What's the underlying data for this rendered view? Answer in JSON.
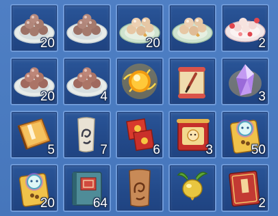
{
  "inventory": {
    "slots": [
      {
        "item": "dumpling-plate-icon",
        "count": "20"
      },
      {
        "item": "dumpling-plate-icon",
        "count": ""
      },
      {
        "item": "tangyuan-plate-icon",
        "count": "20"
      },
      {
        "item": "tangyuan-plate-icon",
        "count": ""
      },
      {
        "item": "tangyuan-flower-plate-icon",
        "count": "2"
      },
      {
        "item": "dumpling-plate-icon",
        "count": "20"
      },
      {
        "item": "dumpling-plate-icon",
        "count": "4"
      },
      {
        "item": "golden-orb-icon",
        "count": ""
      },
      {
        "item": "scroll-brush-icon",
        "count": ""
      },
      {
        "item": "purple-crystal-icon",
        "count": "3"
      },
      {
        "item": "orange-book-icon",
        "count": "5"
      },
      {
        "item": "paper-talisman-icon",
        "count": "7"
      },
      {
        "item": "red-fireworks-icon",
        "count": "6"
      },
      {
        "item": "red-banner-scroll-icon",
        "count": "3"
      },
      {
        "item": "character-ticket-icon",
        "count": "50"
      },
      {
        "item": "character-ticket-icon",
        "count": "20"
      },
      {
        "item": "blue-book-icon",
        "count": "64"
      },
      {
        "item": "brown-talisman-icon",
        "count": ""
      },
      {
        "item": "golden-radish-icon",
        "count": ""
      },
      {
        "item": "red-book-icon",
        "count": "2"
      }
    ]
  },
  "colors": {
    "background": "#4a7bc0",
    "slot_border": "#6f9ad8",
    "slot_fill": "#234a8a",
    "count_text": "#ffffff"
  }
}
